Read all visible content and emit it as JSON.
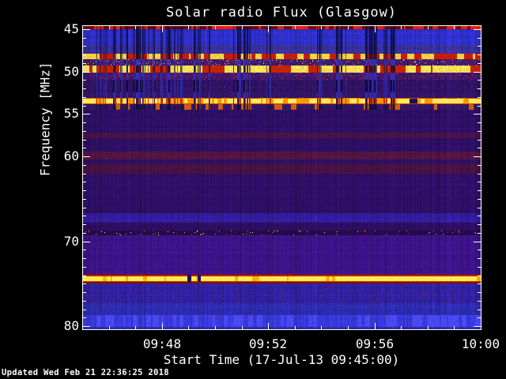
{
  "window": {
    "background": "#000000",
    "text_color": "#ffffff"
  },
  "chart_data": {
    "type": "heatmap",
    "title": "Solar radio Flux (Glasgow)",
    "xlabel": "Start Time (17-Jul-13 09:45:00)",
    "ylabel": "Frequency [MHz]",
    "footer": "Updated Wed Feb 21 22:36:25 2018",
    "colormap": "low = dark blue/indigo, mid = purple/red, high = orange/yellow",
    "x_axis": {
      "start": "09:45:00",
      "end": "10:00:00",
      "duration_min": 15,
      "major_ticks": [
        {
          "label": "09:48",
          "minute": 3
        },
        {
          "label": "09:52",
          "minute": 7
        },
        {
          "label": "09:56",
          "minute": 11
        },
        {
          "label": "10:00",
          "minute": 15
        }
      ],
      "minor_tick_minutes": [
        1,
        2,
        4,
        5,
        6,
        8,
        9,
        10,
        12,
        13,
        14
      ]
    },
    "y_axis": {
      "unit": "MHz",
      "top_mhz": 44.55,
      "bottom_mhz": 80.35,
      "major_ticks": [
        45,
        50,
        55,
        60,
        70,
        80
      ],
      "minor_ticks": [
        46,
        47,
        48,
        49,
        51,
        52,
        53,
        54,
        56,
        57,
        58,
        59,
        61,
        62,
        63,
        64,
        65,
        66,
        67,
        68,
        69,
        71,
        72,
        73,
        74,
        75,
        76,
        77,
        78,
        79
      ]
    },
    "vertical_dropouts": {
      "description": "dark vertical interference streaks between 45 and 54.5 MHz, left ~82% of time range",
      "x_extent_frac": 0.82,
      "clusters": 26,
      "seed": 1234567
    },
    "bands": [
      {
        "f0": 44.55,
        "f1": 44.88,
        "base": "#700505",
        "dash": {
          "c": "#e61e00",
          "p": 0.55,
          "run": 4
        },
        "streak": "dark"
      },
      {
        "f0": 44.88,
        "f1": 46.7,
        "base": "#2e2ec6",
        "tex": 1,
        "streak": "dark"
      },
      {
        "f0": 46.7,
        "f1": 47.8,
        "base": "#37309e",
        "tex": 1,
        "streak": "dark"
      },
      {
        "f0": 47.8,
        "f1": 48.42,
        "base": "#c71c00",
        "dash": {
          "c": "#ffd23c",
          "p": 0.45,
          "run": 5
        },
        "streak": "gapdark"
      },
      {
        "f0": 48.42,
        "f1": 49.2,
        "base": "#401a70",
        "tex": 1,
        "speck": {
          "c": [
            "#e06010",
            "#ffcf30"
          ],
          "p": 0.05
        },
        "streak": "blue"
      },
      {
        "f0": 49.2,
        "f1": 50.06,
        "base": "#c92200",
        "dash": {
          "c": "#ffe055",
          "p": 0.5,
          "run": 8
        },
        "streak": "gapdark"
      },
      {
        "f0": 50.06,
        "f1": 50.92,
        "base": "#3a166c",
        "tex": 1,
        "speck": {
          "c": [
            "#a52239",
            "#cc2a20"
          ],
          "p": 0.08
        },
        "streak": "blue"
      },
      {
        "f0": 50.92,
        "f1": 52.4,
        "base": "#2c1263",
        "tex": 1,
        "speck": {
          "c": [
            "#7e1a30"
          ],
          "p": 0.04
        },
        "streak": "blue2"
      },
      {
        "f0": 52.4,
        "f1": 53.02,
        "base": "#341566",
        "tex": 1,
        "streak": "blue"
      },
      {
        "f0": 53.02,
        "f1": 53.13,
        "base": "#c84400",
        "dash": {
          "c": "#ff7b00",
          "p": 0.35,
          "run": 4
        },
        "streak": "gapred"
      },
      {
        "f0": 53.13,
        "f1": 53.7,
        "base": "#ffe95e",
        "dash": {
          "c": "#ff9a00",
          "p": 0.3,
          "run": 3
        },
        "streak": "gapred",
        "gaps": [
          [
            0.82,
            0.839
          ]
        ]
      },
      {
        "f0": 53.7,
        "f1": 53.82,
        "base": "#cc3e00",
        "streak": "gapred"
      },
      {
        "f0": 53.82,
        "f1": 54.45,
        "base": "#341464",
        "tex": 1,
        "dash": {
          "c": "#cc5c14",
          "p": 0.2,
          "run": 3
        },
        "streak": "dark"
      },
      {
        "f0": 54.45,
        "f1": 57.1,
        "base": "#2d0f63",
        "tex": 1
      },
      {
        "f0": 57.1,
        "f1": 57.8,
        "base": "#48114 4",
        "tex": 1
      },
      {
        "f0": 57.8,
        "f1": 59.4,
        "base": "#2d0f63",
        "tex": 1
      },
      {
        "f0": 59.4,
        "f1": 60.3,
        "base": "#511442",
        "tex": 1
      },
      {
        "f0": 60.3,
        "f1": 60.9,
        "base": "#310f62",
        "tex": 1
      },
      {
        "f0": 60.9,
        "f1": 62.0,
        "base": "#471240",
        "tex": 1
      },
      {
        "f0": 62.0,
        "f1": 66.6,
        "base": "#2e0f66",
        "tex": 1
      },
      {
        "f0": 66.6,
        "f1": 67.8,
        "base": "#331b9a",
        "tex": 1
      },
      {
        "f0": 67.8,
        "f1": 68.7,
        "base": "#2c0e60",
        "tex": 1
      },
      {
        "f0": 68.7,
        "f1": 69.25,
        "base": "#26094b",
        "speck": {
          "c": [
            "#d42200",
            "#ff9500",
            "#ffe944"
          ],
          "p": 0.03
        }
      },
      {
        "f0": 69.25,
        "f1": 73.6,
        "base": "#3a1384",
        "tex": 1
      },
      {
        "f0": 73.6,
        "f1": 73.95,
        "base": "#3a1384",
        "tex": 1,
        "speck": {
          "c": [
            "#73213f"
          ],
          "p": 0.1
        }
      },
      {
        "f0": 73.95,
        "f1": 74.12,
        "base": "#c41e00",
        "gaps": [
          [
            0.262,
            0.271
          ],
          [
            0.288,
            0.295
          ]
        ]
      },
      {
        "f0": 74.12,
        "f1": 74.66,
        "base": "#ffec50",
        "dash": {
          "c": "#ffb400",
          "p": 0.12,
          "run": 2
        },
        "gaps": [
          [
            0.262,
            0.271
          ],
          [
            0.288,
            0.295
          ]
        ]
      },
      {
        "f0": 74.66,
        "f1": 74.8,
        "base": "#cc3c00",
        "gaps": [
          [
            0.262,
            0.271
          ],
          [
            0.288,
            0.295
          ]
        ]
      },
      {
        "f0": 74.8,
        "f1": 74.94,
        "base": "#7c1200"
      },
      {
        "f0": 74.94,
        "f1": 77.3,
        "base": "#30209d",
        "tex": 1,
        "speck": {
          "c": [
            "#b02020"
          ],
          "p": 0.008
        }
      },
      {
        "f0": 77.3,
        "f1": 78.7,
        "base": "#2e2bb0",
        "tex": 1
      },
      {
        "f0": 78.7,
        "f1": 80.06,
        "base": "#3737d9",
        "tex": 1,
        "dash": {
          "c": "#4848f2",
          "p": 0.35,
          "run": 3
        },
        "speck": {
          "c": [
            "#cc3a10"
          ],
          "p": 0.004
        }
      },
      {
        "f0": 80.06,
        "f1": 80.35,
        "base": "#2b2ba6",
        "tex": 1
      }
    ]
  }
}
